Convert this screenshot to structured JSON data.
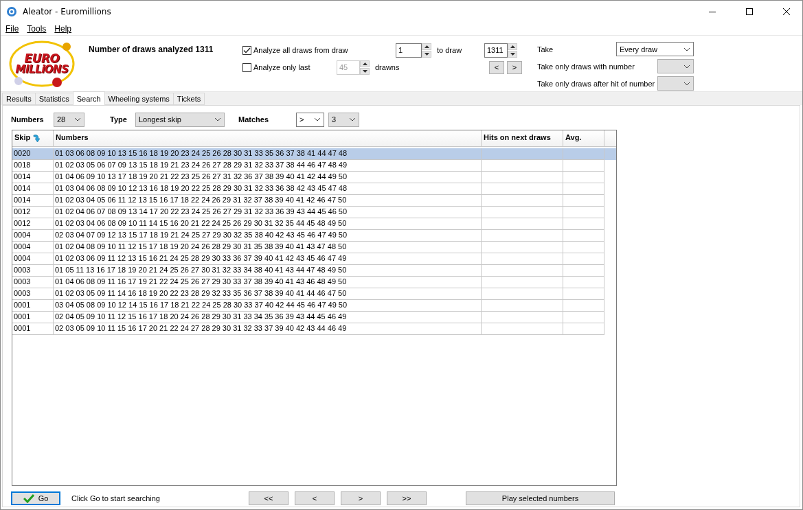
{
  "window": {
    "title": "Aleator - Euromillions"
  },
  "menu": [
    "File",
    "Tools",
    "Help"
  ],
  "logo": {
    "line1": "EURO",
    "line2": "MILLiONS"
  },
  "summary": "Number of draws analyzed 1311",
  "range": {
    "analyze_all": {
      "label": "Analyze all draws from draw",
      "checked": true
    },
    "from_value": "1",
    "to_label": "to draw",
    "to_value": "1311",
    "analyze_last": {
      "label": "Analyze only last",
      "checked": false
    },
    "last_value": "45",
    "last_disabled": true,
    "last_suffix": "drawns",
    "prev": "<",
    "next": ">"
  },
  "take": [
    {
      "label": "Take",
      "value": "Every draw"
    },
    {
      "label": "Take only draws with number"
    },
    {
      "label": "Take only draws after hit of number"
    }
  ],
  "tabs": [
    {
      "label": "Results",
      "selected": false
    },
    {
      "label": "Statistics",
      "selected": false
    },
    {
      "label": "Search",
      "selected": true
    },
    {
      "label": "Wheeling systems",
      "selected": false
    },
    {
      "label": "Tickets",
      "selected": false
    }
  ],
  "filters": {
    "numbers_label": "Numbers",
    "numbers_value": "28",
    "type_label": "Type",
    "type_value": "Longest skip",
    "matches_label": "Matches",
    "operator": ">",
    "matches_value": "3"
  },
  "table": {
    "columns": [
      "Skip",
      "Numbers",
      "Hits on next draws",
      "Avg."
    ],
    "rows": [
      {
        "skip": "0020",
        "numbers": "01 03 06 08 09 10 13 15 16 18 19 20 23 24 25 26 28 30 31 33 35 36 37 38 41 44 47 48",
        "selected": true
      },
      {
        "skip": "0018",
        "numbers": "01 02 03 05 06 07 09 13 15 18 19 21 23 24 26 27 28 29 31 32 33 37 38 44 46 47 48 49",
        "selected": false
      },
      {
        "skip": "0014",
        "numbers": "01 04 06 09 10 13 17 18 19 20 21 22 23 25 26 27 31 32 36 37 38 39 40 41 42 44 49 50",
        "selected": false
      },
      {
        "skip": "0014",
        "numbers": "01 03 04 06 08 09 10 12 13 16 18 19 20 22 25 28 29 30 31 32 33 36 38 42 43 45 47 48",
        "selected": false
      },
      {
        "skip": "0014",
        "numbers": "01 02 03 04 05 06 11 12 13 15 16 17 18 22 24 26 29 31 32 37 38 39 40 41 42 46 47 50",
        "selected": false
      },
      {
        "skip": "0012",
        "numbers": "01 02 04 06 07 08 09 13 14 17 20 22 23 24 25 26 27 29 31 32 33 36 39 43 44 45 46 50",
        "selected": false
      },
      {
        "skip": "0012",
        "numbers": "01 02 03 04 06 08 09 10 11 14 15 16 20 21 22 24 25 26 29 30 31 32 35 44 45 48 49 50",
        "selected": false
      },
      {
        "skip": "0004",
        "numbers": "02 03 04 07 09 12 13 15 17 18 19 21 24 25 27 29 30 32 35 38 40 42 43 45 46 47 49 50",
        "selected": false
      },
      {
        "skip": "0004",
        "numbers": "01 02 04 08 09 10 11 12 15 17 18 19 20 24 26 28 29 30 31 35 38 39 40 41 43 47 48 50",
        "selected": false
      },
      {
        "skip": "0004",
        "numbers": "01 02 03 06 09 11 12 13 15 16 21 24 25 28 29 30 33 36 37 39 40 41 42 43 45 46 47 49",
        "selected": false
      },
      {
        "skip": "0003",
        "numbers": "01 05 11 13 16 17 18 19 20 21 24 25 26 27 30 31 32 33 34 38 40 41 43 44 47 48 49 50",
        "selected": false
      },
      {
        "skip": "0003",
        "numbers": "01 04 06 08 09 11 16 17 19 21 22 24 25 26 27 29 30 33 37 38 39 40 41 43 46 48 49 50",
        "selected": false
      },
      {
        "skip": "0003",
        "numbers": "01 02 03 05 09 11 14 16 18 19 20 22 23 28 29 32 33 35 36 37 38 39 40 41 44 46 47 50",
        "selected": false
      },
      {
        "skip": "0001",
        "numbers": "03 04 05 08 09 10 12 14 15 16 17 18 21 22 24 25 28 30 33 37 40 42 44 45 46 47 49 50",
        "selected": false
      },
      {
        "skip": "0001",
        "numbers": "02 04 05 09 10 11 12 15 16 17 18 20 24 26 28 29 30 31 33 34 35 36 39 43 44 45 46 49",
        "selected": false
      },
      {
        "skip": "0001",
        "numbers": "02 03 05 09 10 11 15 16 17 20 21 22 24 27 28 29 30 31 32 33 37 39 40 42 43 44 46 49",
        "selected": false
      }
    ]
  },
  "footer": {
    "go": "Go",
    "hint": "Click Go to start searching",
    "nav": [
      "<<",
      "<",
      ">",
      ">>"
    ],
    "play": "Play selected numbers"
  }
}
